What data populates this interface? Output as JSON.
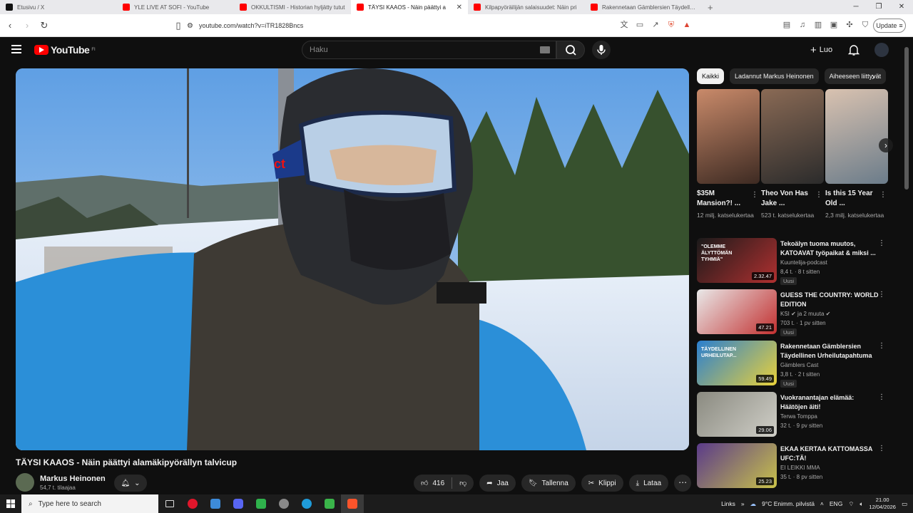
{
  "browser": {
    "tabs": [
      {
        "title": "Etusivu / X",
        "favicon_color": "#111111",
        "active": false
      },
      {
        "title": "YLE LIVE AT SOFI - YouTube",
        "favicon_color": "#ff0000",
        "active": false
      },
      {
        "title": "OKKULTISMI - Historian hyljätty tutut",
        "favicon_color": "#ff0000",
        "active": false
      },
      {
        "title": "TÄYSI KAAOS - Näin päättyi a",
        "favicon_color": "#ff0000",
        "active": true
      },
      {
        "title": "Kilpapyöräilijän salaisuudet: Näin pri",
        "favicon_color": "#ff0000",
        "active": false
      },
      {
        "title": "Rakennetaan Gämblersien Täydelline",
        "favicon_color": "#ff0000",
        "active": false
      }
    ],
    "url": "youtube.com/watch?v=iTR1828Bncs",
    "update_label": "Update"
  },
  "youtube": {
    "logo_text": "YouTube",
    "logo_region": "FI",
    "search_placeholder": "Haku",
    "create_label": "Luo",
    "video": {
      "title": "TÄYSI KAAOS - Näin päättyi alamäkipyörällyn talvicup",
      "channel": "Markus Heinonen",
      "subscribers": "54,7 t. tilaajaa",
      "likes": "416",
      "share_label": "Jaa",
      "save_label": "Tallenna",
      "clip_label": "Klippi",
      "download_label": "Lataa"
    },
    "chips": [
      "Kaikki",
      "Ladannut Markus Heinonen",
      "Aiheeseen liittyvät"
    ],
    "shorts": [
      {
        "title": "$35M Mansion?! ...",
        "views": "12 milj. katselukertaa",
        "colors": [
          "#c98a6a",
          "#3d2a22"
        ]
      },
      {
        "title": "Theo Von Has Jake ...",
        "views": "523 t. katselukertaa",
        "colors": [
          "#8a6a55",
          "#2b2b2b"
        ]
      },
      {
        "title": "Is this 15 Year Old ...",
        "views": "2,3 milj. katselukertaa",
        "colors": [
          "#d9c2b0",
          "#6b7c8a"
        ]
      }
    ],
    "recommendations": [
      {
        "title": "Tekoälyn tuoma muutos, KATOAVAT työpaikat & miksi ...",
        "channel": "Kuuntelija-podcast",
        "meta": "8,4 t. · 8 t sitten",
        "badge": "Uusi",
        "duration": "2.32.47",
        "colors": [
          "#1a1a1a",
          "#b03030"
        ],
        "thumb_text": "\"OLEMME ÄLYTTÖMÄN TYHMIÄ\""
      },
      {
        "title": "GUESS THE COUNTRY: WORLD EDITION",
        "channel": "KSI ✔ ja 2 muuta ✔",
        "meta": "703 t. · 1 pv sitten",
        "badge": "Uusi",
        "duration": "47.21",
        "colors": [
          "#e9e9e9",
          "#c23030"
        ],
        "thumb_text": ""
      },
      {
        "title": "Rakennetaan Gämblersien Täydellinen Urheilutapahtuma",
        "channel": "Gämblers Cast",
        "meta": "3,8 t. · 2 t sitten",
        "badge": "Uusi",
        "duration": "59.49",
        "colors": [
          "#2a7fd0",
          "#e9d13a"
        ],
        "thumb_text": "TÄYDELLINEN URHEILUTAP..."
      },
      {
        "title": "Vuokranantajan elämää: Häätöjen äiti!",
        "channel": "Terwa Tomppa",
        "meta": "32 t. · 9 pv sitten",
        "badge": "",
        "duration": "29.06",
        "colors": [
          "#8a8a80",
          "#d0cfc8"
        ],
        "thumb_text": ""
      },
      {
        "title": "EKAA KERTAA KATTOMASSA UFC:TÄ!",
        "channel": "EI LEIKKI MMA",
        "meta": "35 t. · 8 pv sitten",
        "badge": "",
        "duration": "25.23",
        "colors": [
          "#5a3a8a",
          "#c9c24a"
        ],
        "thumb_text": ""
      }
    ]
  },
  "taskbar": {
    "search_placeholder": "Type here to search",
    "links_label": "Links",
    "weather": "9°C  Enimm. pilvistä",
    "lang": "ENG",
    "time": "21.00",
    "date": "12/04/2026"
  }
}
